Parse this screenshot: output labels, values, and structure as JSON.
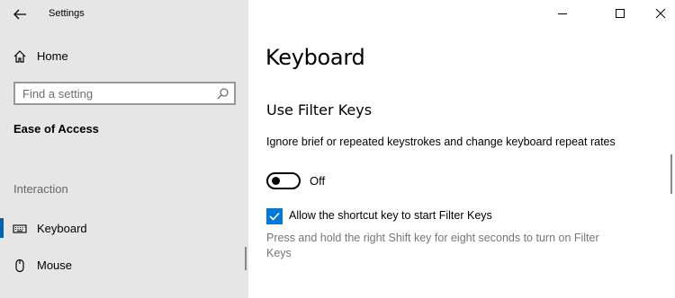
{
  "window": {
    "app_title": "Settings",
    "controls": [
      "minimize-icon",
      "maximize-icon",
      "close-icon"
    ]
  },
  "sidebar": {
    "home_label": "Home",
    "search": {
      "placeholder": "Find a setting",
      "value": ""
    },
    "section_title": "Ease of Access",
    "group_label": "Interaction",
    "items": [
      {
        "label": "Keyboard",
        "icon": "keyboard-icon",
        "active": true
      },
      {
        "label": "Mouse",
        "icon": "mouse-icon",
        "active": false
      }
    ]
  },
  "main": {
    "page_title": "Keyboard",
    "section_title": "Use Filter Keys",
    "description": "Ignore brief or repeated keystrokes and change keyboard repeat rates",
    "toggle": {
      "state_label": "Off",
      "on": false
    },
    "shortcut_checkbox": {
      "label": "Allow the shortcut key to start Filter Keys",
      "checked": true
    },
    "shortcut_hint": "Press and hold the right Shift key for eight seconds to turn on Filter Keys"
  },
  "colors": {
    "sidebar_bg": "#e6e6e6",
    "accent": "#0078d7",
    "active_indicator": "#0063b1",
    "hint_text": "#767676"
  }
}
